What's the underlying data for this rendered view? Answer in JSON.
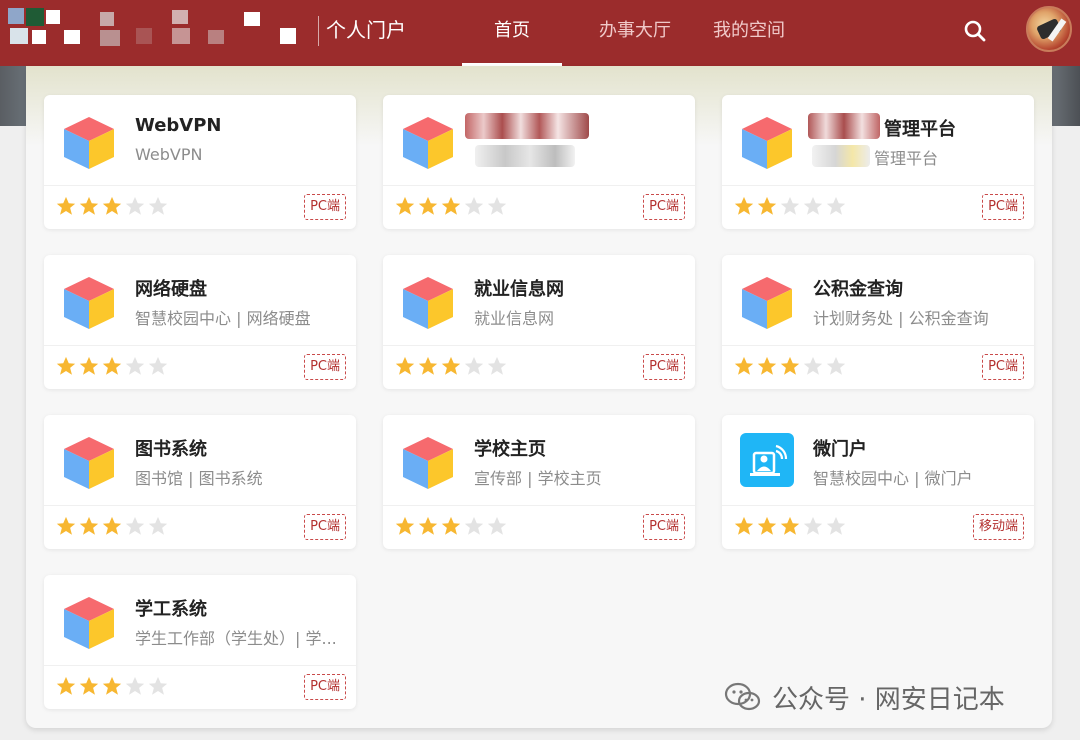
{
  "header": {
    "portal_title": "个人门户",
    "nav": [
      {
        "label": "首页",
        "active": true
      },
      {
        "label": "办事大厅",
        "active": false
      },
      {
        "label": "我的空间",
        "active": false
      }
    ],
    "search_icon": "search-icon",
    "brand_color": "#9b2c2c"
  },
  "apps": [
    {
      "name": "WebVPN",
      "sub": "WebVPN",
      "rating": 3,
      "platform": "PC端",
      "icon": "cube-icon"
    },
    {
      "name": "",
      "sub": "",
      "rating": 3,
      "platform": "PC端",
      "icon": "cube-icon",
      "redacted": true
    },
    {
      "name": "管理平台",
      "sub": "管理平台",
      "rating": 2,
      "platform": "PC端",
      "icon": "cube-icon",
      "redacted": true
    },
    {
      "name": "网络硬盘",
      "sub": "智慧校园中心 | 网络硬盘",
      "rating": 3,
      "platform": "PC端",
      "icon": "cube-icon"
    },
    {
      "name": "就业信息网",
      "sub": "就业信息网",
      "rating": 3,
      "platform": "PC端",
      "icon": "cube-icon"
    },
    {
      "name": "公积金查询",
      "sub": "计划财务处 | 公积金查询",
      "rating": 3,
      "platform": "PC端",
      "icon": "cube-icon"
    },
    {
      "name": "图书系统",
      "sub": "图书馆 | 图书系统",
      "rating": 3,
      "platform": "PC端",
      "icon": "cube-icon"
    },
    {
      "name": "学校主页",
      "sub": "宣传部 | 学校主页",
      "rating": 3,
      "platform": "PC端",
      "icon": "cube-icon"
    },
    {
      "name": "微门户",
      "sub": "智慧校园中心 | 微门户",
      "rating": 3,
      "platform": "移动端",
      "icon": "mobile-portal-icon"
    },
    {
      "name": "学工系统",
      "sub": "学生工作部（学生处）| 学...",
      "rating": 3,
      "platform": "PC端",
      "icon": "cube-icon"
    }
  ],
  "watermark": "公众号 · 网安日记本",
  "colors": {
    "star_on": "#f7b731",
    "star_off": "#e3e3e3",
    "badge": "#b3302f"
  }
}
